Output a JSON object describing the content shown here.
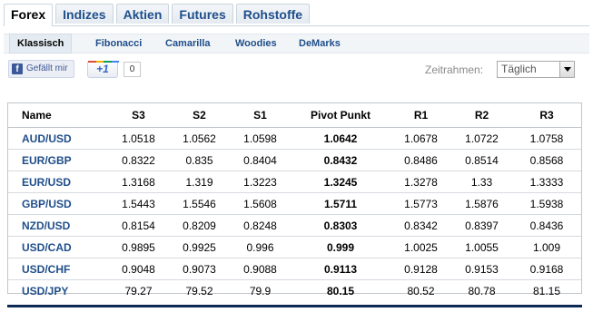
{
  "tabs": [
    {
      "label": "Forex",
      "active": true
    },
    {
      "label": "Indizes",
      "active": false
    },
    {
      "label": "Aktien",
      "active": false
    },
    {
      "label": "Futures",
      "active": false
    },
    {
      "label": "Rohstoffe",
      "active": false
    }
  ],
  "subtabs": [
    {
      "label": "Klassisch",
      "active": true
    },
    {
      "label": "Fibonacci",
      "active": false
    },
    {
      "label": "Camarilla",
      "active": false
    },
    {
      "label": "Woodies",
      "active": false
    },
    {
      "label": "DeMarks",
      "active": false
    }
  ],
  "social": {
    "facebook_label": "Gefällt mir",
    "facebook_icon": "f",
    "gplus_label": "+1",
    "gplus_count": "0",
    "gplus_colors": [
      "#dd4b39",
      "#f4b400",
      "#0f9d58",
      "#4285f4"
    ]
  },
  "timeframe": {
    "label": "Zeitrahmen:",
    "selected": "Täglich"
  },
  "table": {
    "headers": [
      "Name",
      "S3",
      "S2",
      "S1",
      "Pivot Punkt",
      "R1",
      "R2",
      "R3"
    ],
    "rows": [
      [
        "AUD/USD",
        "1.0518",
        "1.0562",
        "1.0598",
        "1.0642",
        "1.0678",
        "1.0722",
        "1.0758"
      ],
      [
        "EUR/GBP",
        "0.8322",
        "0.835",
        "0.8404",
        "0.8432",
        "0.8486",
        "0.8514",
        "0.8568"
      ],
      [
        "EUR/USD",
        "1.3168",
        "1.319",
        "1.3223",
        "1.3245",
        "1.3278",
        "1.33",
        "1.3333"
      ],
      [
        "GBP/USD",
        "1.5443",
        "1.5546",
        "1.5608",
        "1.5711",
        "1.5773",
        "1.5876",
        "1.5938"
      ],
      [
        "NZD/USD",
        "0.8154",
        "0.8209",
        "0.8248",
        "0.8303",
        "0.8342",
        "0.8397",
        "0.8436"
      ],
      [
        "USD/CAD",
        "0.9895",
        "0.9925",
        "0.996",
        "0.999",
        "1.0025",
        "1.0055",
        "1.009"
      ],
      [
        "USD/CHF",
        "0.9048",
        "0.9073",
        "0.9088",
        "0.9113",
        "0.9128",
        "0.9153",
        "0.9168"
      ],
      [
        "USD/JPY",
        "79.27",
        "79.52",
        "79.9",
        "80.15",
        "80.52",
        "80.78",
        "81.15"
      ]
    ]
  },
  "colors": {
    "link": "#1f4e8a",
    "bottom_bar": "#0c2a55",
    "facebook": "#3b5998"
  }
}
